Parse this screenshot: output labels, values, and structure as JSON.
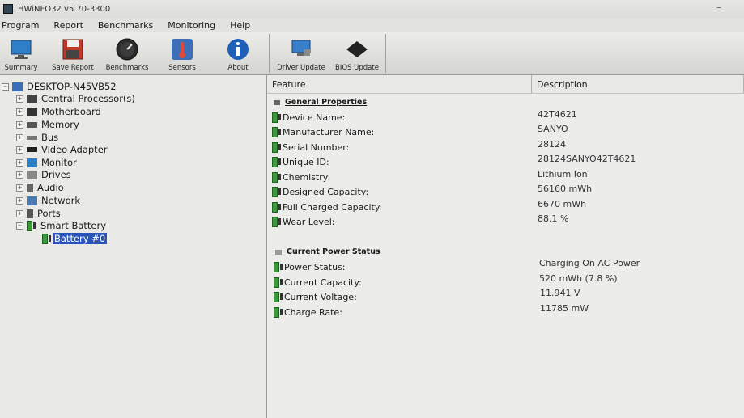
{
  "window": {
    "title": "HWiNFO32 v5.70-3300",
    "minimize_glyph": "–"
  },
  "menu": [
    "Program",
    "Report",
    "Benchmarks",
    "Monitoring",
    "Help"
  ],
  "toolbar": {
    "left": [
      {
        "label": "Summary",
        "icon": "monitor-icon"
      },
      {
        "label": "Save Report",
        "icon": "floppy-disk-icon"
      },
      {
        "label": "Benchmarks",
        "icon": "stopwatch-icon"
      },
      {
        "label": "Sensors",
        "icon": "thermometer-icon"
      },
      {
        "label": "About",
        "icon": "info-icon"
      }
    ],
    "right": [
      {
        "label": "Driver Update",
        "icon": "driver-update-icon"
      },
      {
        "label": "BIOS Update",
        "icon": "chip-icon"
      }
    ]
  },
  "tree": {
    "root": "DESKTOP-N45VB52",
    "items": [
      "Central Processor(s)",
      "Motherboard",
      "Memory",
      "Bus",
      "Video Adapter",
      "Monitor",
      "Drives",
      "Audio",
      "Network",
      "Ports",
      "Smart Battery"
    ],
    "child": "Battery #0"
  },
  "columns": {
    "feature": "Feature",
    "description": "Description"
  },
  "sections": [
    {
      "title": "General Properties",
      "rows": [
        {
          "feature": "Device Name:",
          "value": "42T4621"
        },
        {
          "feature": "Manufacturer Name:",
          "value": "SANYO"
        },
        {
          "feature": "Serial Number:",
          "value": "28124"
        },
        {
          "feature": "Unique ID:",
          "value": "28124SANYO42T4621"
        },
        {
          "feature": "Chemistry:",
          "value": "Lithium Ion"
        },
        {
          "feature": "Designed Capacity:",
          "value": "56160 mWh"
        },
        {
          "feature": "Full Charged Capacity:",
          "value": "6670 mWh"
        },
        {
          "feature": "Wear Level:",
          "value": "88.1 %"
        }
      ]
    },
    {
      "title": "Current Power Status",
      "rows": [
        {
          "feature": "Power Status:",
          "value": "Charging On AC Power"
        },
        {
          "feature": "Current Capacity:",
          "value": "520 mWh (7.8 %)"
        },
        {
          "feature": "Current Voltage:",
          "value": "11.941 V"
        },
        {
          "feature": "Charge Rate:",
          "value": "11785 mW"
        }
      ]
    }
  ],
  "colors": {
    "selection": "#2a55b8",
    "battery_green": "#3a9a3a"
  }
}
